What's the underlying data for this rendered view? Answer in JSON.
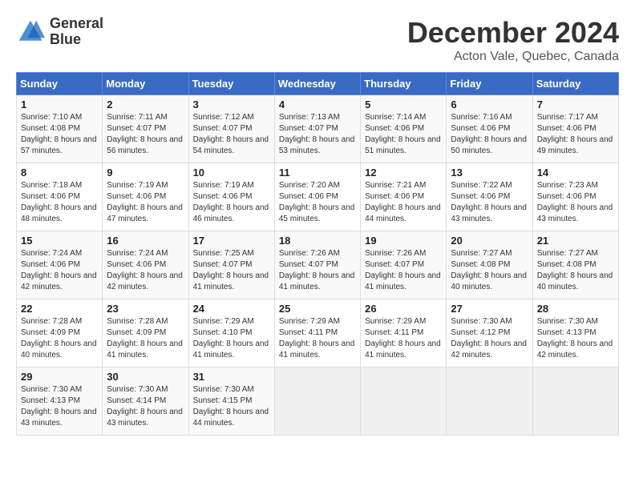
{
  "header": {
    "logo_line1": "General",
    "logo_line2": "Blue",
    "month_title": "December 2024",
    "subtitle": "Acton Vale, Quebec, Canada"
  },
  "weekdays": [
    "Sunday",
    "Monday",
    "Tuesday",
    "Wednesday",
    "Thursday",
    "Friday",
    "Saturday"
  ],
  "weeks": [
    [
      {
        "day": "1",
        "sunrise": "7:10 AM",
        "sunset": "4:08 PM",
        "daylight": "8 hours and 57 minutes."
      },
      {
        "day": "2",
        "sunrise": "7:11 AM",
        "sunset": "4:07 PM",
        "daylight": "8 hours and 56 minutes."
      },
      {
        "day": "3",
        "sunrise": "7:12 AM",
        "sunset": "4:07 PM",
        "daylight": "8 hours and 54 minutes."
      },
      {
        "day": "4",
        "sunrise": "7:13 AM",
        "sunset": "4:07 PM",
        "daylight": "8 hours and 53 minutes."
      },
      {
        "day": "5",
        "sunrise": "7:14 AM",
        "sunset": "4:06 PM",
        "daylight": "8 hours and 51 minutes."
      },
      {
        "day": "6",
        "sunrise": "7:16 AM",
        "sunset": "4:06 PM",
        "daylight": "8 hours and 50 minutes."
      },
      {
        "day": "7",
        "sunrise": "7:17 AM",
        "sunset": "4:06 PM",
        "daylight": "8 hours and 49 minutes."
      }
    ],
    [
      {
        "day": "8",
        "sunrise": "7:18 AM",
        "sunset": "4:06 PM",
        "daylight": "8 hours and 48 minutes."
      },
      {
        "day": "9",
        "sunrise": "7:19 AM",
        "sunset": "4:06 PM",
        "daylight": "8 hours and 47 minutes."
      },
      {
        "day": "10",
        "sunrise": "7:19 AM",
        "sunset": "4:06 PM",
        "daylight": "8 hours and 46 minutes."
      },
      {
        "day": "11",
        "sunrise": "7:20 AM",
        "sunset": "4:06 PM",
        "daylight": "8 hours and 45 minutes."
      },
      {
        "day": "12",
        "sunrise": "7:21 AM",
        "sunset": "4:06 PM",
        "daylight": "8 hours and 44 minutes."
      },
      {
        "day": "13",
        "sunrise": "7:22 AM",
        "sunset": "4:06 PM",
        "daylight": "8 hours and 43 minutes."
      },
      {
        "day": "14",
        "sunrise": "7:23 AM",
        "sunset": "4:06 PM",
        "daylight": "8 hours and 43 minutes."
      }
    ],
    [
      {
        "day": "15",
        "sunrise": "7:24 AM",
        "sunset": "4:06 PM",
        "daylight": "8 hours and 42 minutes."
      },
      {
        "day": "16",
        "sunrise": "7:24 AM",
        "sunset": "4:06 PM",
        "daylight": "8 hours and 42 minutes."
      },
      {
        "day": "17",
        "sunrise": "7:25 AM",
        "sunset": "4:07 PM",
        "daylight": "8 hours and 41 minutes."
      },
      {
        "day": "18",
        "sunrise": "7:26 AM",
        "sunset": "4:07 PM",
        "daylight": "8 hours and 41 minutes."
      },
      {
        "day": "19",
        "sunrise": "7:26 AM",
        "sunset": "4:07 PM",
        "daylight": "8 hours and 41 minutes."
      },
      {
        "day": "20",
        "sunrise": "7:27 AM",
        "sunset": "4:08 PM",
        "daylight": "8 hours and 40 minutes."
      },
      {
        "day": "21",
        "sunrise": "7:27 AM",
        "sunset": "4:08 PM",
        "daylight": "8 hours and 40 minutes."
      }
    ],
    [
      {
        "day": "22",
        "sunrise": "7:28 AM",
        "sunset": "4:09 PM",
        "daylight": "8 hours and 40 minutes."
      },
      {
        "day": "23",
        "sunrise": "7:28 AM",
        "sunset": "4:09 PM",
        "daylight": "8 hours and 41 minutes."
      },
      {
        "day": "24",
        "sunrise": "7:29 AM",
        "sunset": "4:10 PM",
        "daylight": "8 hours and 41 minutes."
      },
      {
        "day": "25",
        "sunrise": "7:29 AM",
        "sunset": "4:11 PM",
        "daylight": "8 hours and 41 minutes."
      },
      {
        "day": "26",
        "sunrise": "7:29 AM",
        "sunset": "4:11 PM",
        "daylight": "8 hours and 41 minutes."
      },
      {
        "day": "27",
        "sunrise": "7:30 AM",
        "sunset": "4:12 PM",
        "daylight": "8 hours and 42 minutes."
      },
      {
        "day": "28",
        "sunrise": "7:30 AM",
        "sunset": "4:13 PM",
        "daylight": "8 hours and 42 minutes."
      }
    ],
    [
      {
        "day": "29",
        "sunrise": "7:30 AM",
        "sunset": "4:13 PM",
        "daylight": "8 hours and 43 minutes."
      },
      {
        "day": "30",
        "sunrise": "7:30 AM",
        "sunset": "4:14 PM",
        "daylight": "8 hours and 43 minutes."
      },
      {
        "day": "31",
        "sunrise": "7:30 AM",
        "sunset": "4:15 PM",
        "daylight": "8 hours and 44 minutes."
      },
      null,
      null,
      null,
      null
    ]
  ]
}
